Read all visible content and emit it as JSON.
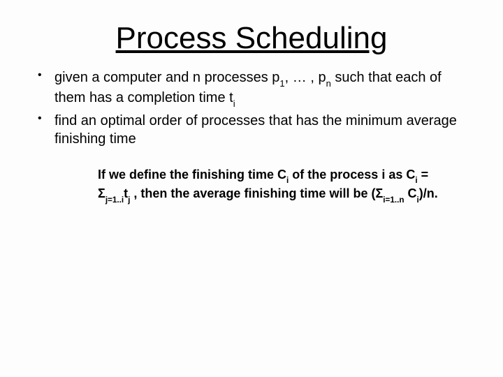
{
  "title": "Process Scheduling",
  "bullets": [
    {
      "pre": "given a computer and n processes p",
      "s1": "1",
      "mid1": ", … , p",
      "s2": "n",
      "mid2": " such that each of them has a completion time t",
      "s3": "i",
      "post": ""
    },
    {
      "pre": "find an optimal order of processes that has the minimum average finishing time",
      "s1": "",
      "mid1": "",
      "s2": "",
      "mid2": "",
      "s3": "",
      "post": ""
    }
  ],
  "note": {
    "t1": "If we define the finishing time C",
    "s1": "i",
    "t2": " of the process i as C",
    "s2": "i",
    "t3": " = Σ",
    "s3": "j=1..i",
    "t4": "t",
    "s4": "j",
    "t5": " , then the average finishing time will be  (Σ",
    "s5": "i=1..n",
    "t6": " C",
    "s6": "i",
    "t7": ")/n."
  }
}
